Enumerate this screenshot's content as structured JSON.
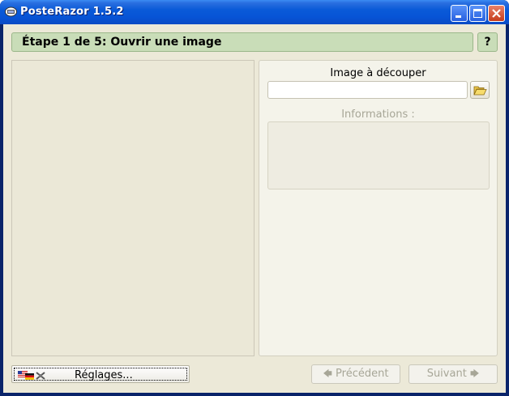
{
  "window": {
    "title": "PosteRazor 1.5.2",
    "controls": [
      "minimize-icon",
      "maximize-icon",
      "close-icon"
    ]
  },
  "step": {
    "title": "Étape 1 de 5: Ouvrir une image",
    "help_label": "?"
  },
  "image_input": {
    "label": "Image à découper",
    "value": "",
    "browse_icon": "folder-open-icon"
  },
  "info": {
    "label": "Informations :"
  },
  "footer": {
    "settings_label": "Réglages...",
    "settings_icons": [
      "flags-icon",
      "tools-icon"
    ],
    "prev_label": "Précédent",
    "next_label": "Suivant",
    "prev_icon": "arrow-left-icon",
    "next_icon": "arrow-right-icon"
  },
  "colors": {
    "titlebar": "#0a5ad8",
    "step_bar": "#c9ddb8",
    "dialog_bg": "#ece9d8",
    "disabled_text": "#a7a697"
  }
}
